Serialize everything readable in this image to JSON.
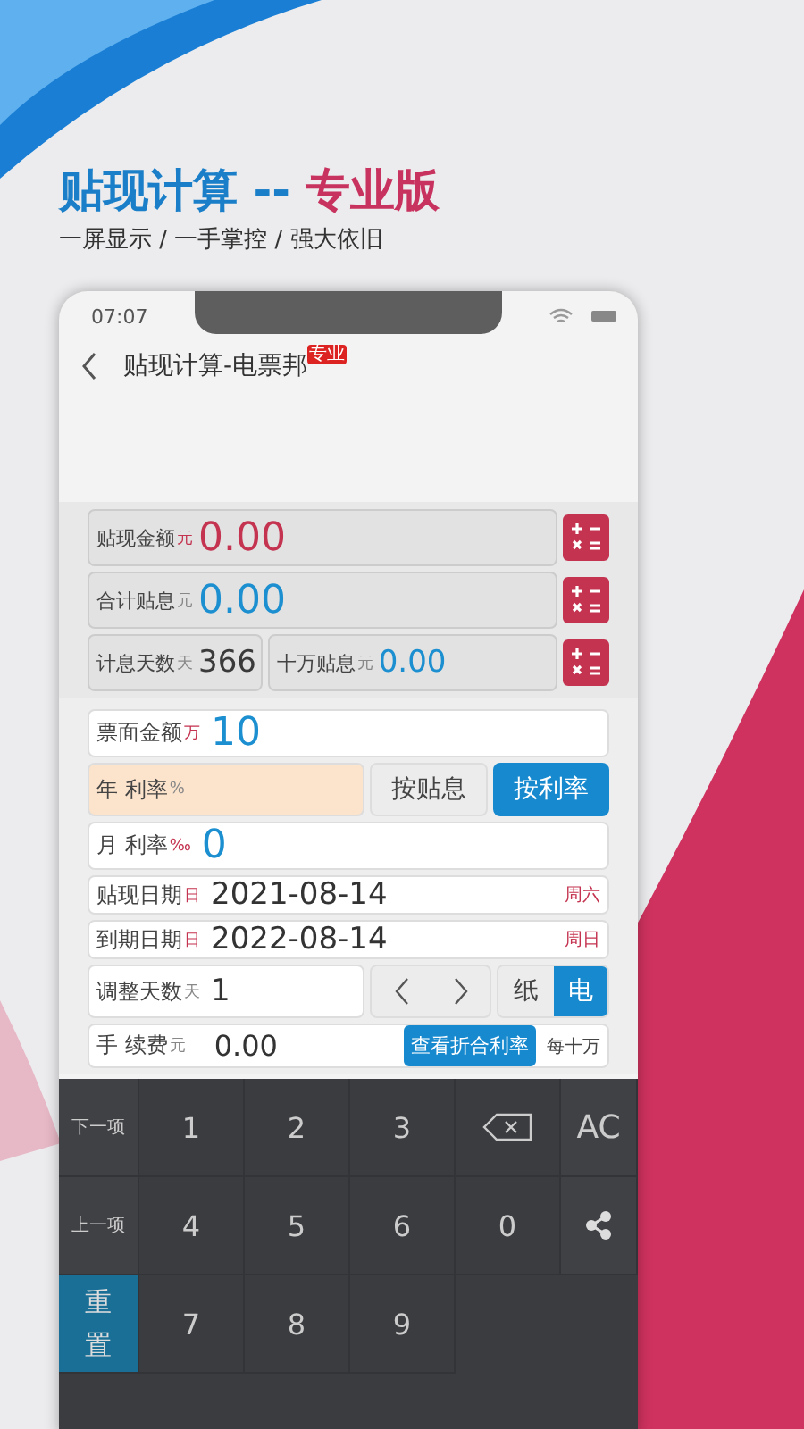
{
  "header": {
    "title_main": "贴现计算",
    "title_sep": "--",
    "title_accent": "专业版",
    "subtitle": "一屏显示 / 一手掌控 / 强大依旧"
  },
  "status_bar": {
    "time": "07:07"
  },
  "nav": {
    "title": "贴现计算-电票邦",
    "badge": "专业"
  },
  "results": [
    {
      "cells": [
        {
          "label": "贴现金额",
          "unit": "元",
          "value": "0.00",
          "color": "#c43350"
        }
      ]
    },
    {
      "cells": [
        {
          "label": "合计贴息",
          "unit": "元",
          "value": "0.00",
          "color": "#1c8fd0"
        }
      ]
    },
    {
      "cells": [
        {
          "label": "计息天数",
          "unit": "天",
          "value": "366",
          "color": "#3a3a3a"
        },
        {
          "label": "十万贴息",
          "unit": "元",
          "value": "0.00",
          "color": "#1c8fd0"
        }
      ]
    }
  ],
  "form": [
    {
      "kind": "amount",
      "label": "票面金额",
      "unit": "万",
      "value": "10"
    },
    {
      "kind": "rate_mode",
      "label": "年 利率",
      "unit": "%",
      "options": [
        {
          "label": "按贴息",
          "selected": false
        },
        {
          "label": "按利率",
          "selected": true
        }
      ]
    },
    {
      "kind": "amount",
      "label": "月 利率",
      "unit": "‰",
      "value": "0"
    },
    {
      "kind": "date",
      "label": "贴现日期",
      "unit": "日",
      "value": "2021-08-14",
      "weekday": "周六"
    },
    {
      "kind": "date",
      "label": "到期日期",
      "unit": "日",
      "value": "2022-08-14",
      "weekday": "周日"
    },
    {
      "kind": "adjust",
      "label": "调整天数",
      "unit": "天",
      "value": "1",
      "types": [
        {
          "label": "纸",
          "selected": false
        },
        {
          "label": "电",
          "selected": true
        }
      ]
    },
    {
      "kind": "fee",
      "label": "手 续费",
      "unit": "元",
      "value": "0.00",
      "button": "查看折合利率",
      "suffix": "每十万"
    }
  ],
  "keypad": [
    [
      {
        "kind": "side",
        "label": "下一项"
      },
      {
        "kind": "digit",
        "label": "1"
      },
      {
        "kind": "digit",
        "label": "2"
      },
      {
        "kind": "digit",
        "label": "3"
      },
      {
        "kind": "backspace"
      },
      {
        "kind": "text",
        "label": "AC"
      }
    ],
    [
      {
        "kind": "side",
        "label": "上一项"
      },
      {
        "kind": "digit",
        "label": "4"
      },
      {
        "kind": "digit",
        "label": "5"
      },
      {
        "kind": "digit",
        "label": "6"
      },
      {
        "kind": "digit",
        "label": "0"
      },
      {
        "kind": "share"
      }
    ],
    [
      {
        "kind": "reset",
        "label": "重置"
      },
      {
        "kind": "digit",
        "label": "7"
      },
      {
        "kind": "digit",
        "label": "8"
      },
      {
        "kind": "digit",
        "label": "9"
      }
    ]
  ]
}
